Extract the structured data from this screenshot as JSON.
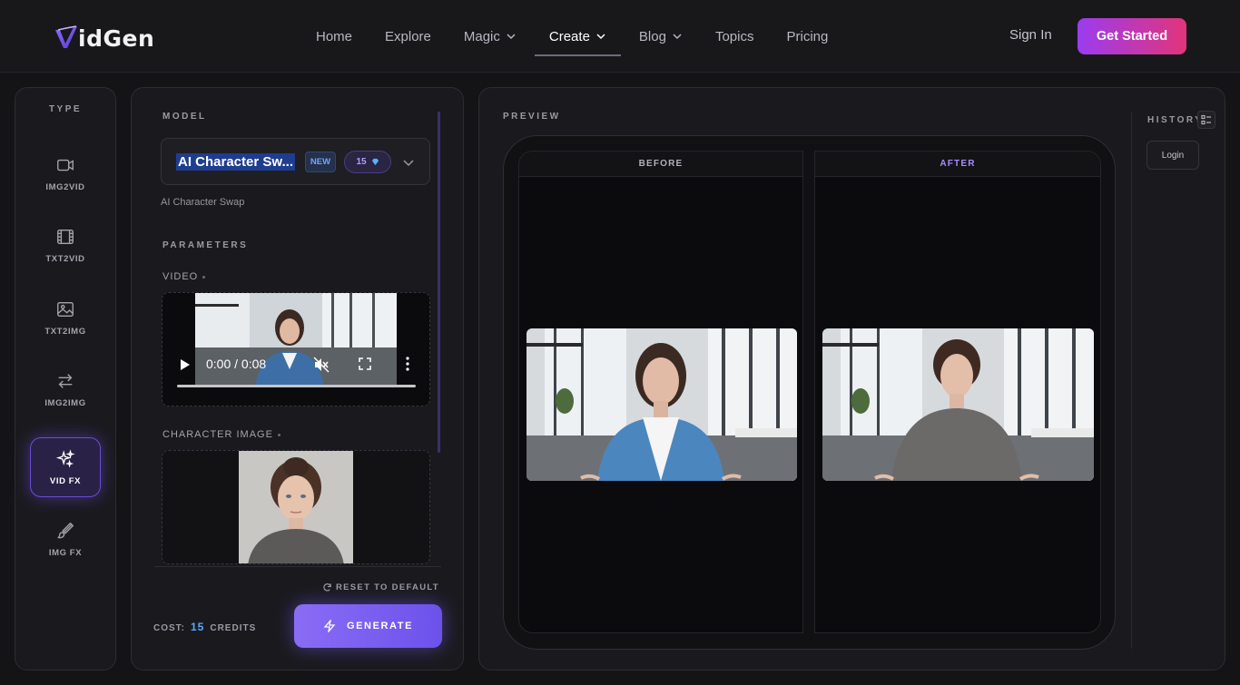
{
  "header": {
    "logo_text": "idGen",
    "nav": [
      {
        "label": "Home",
        "has_menu": false
      },
      {
        "label": "Explore",
        "has_menu": false
      },
      {
        "label": "Magic",
        "has_menu": true
      },
      {
        "label": "Create",
        "has_menu": true,
        "active": true
      },
      {
        "label": "Blog",
        "has_menu": true
      },
      {
        "label": "Topics",
        "has_menu": false
      },
      {
        "label": "Pricing",
        "has_menu": false
      }
    ],
    "sign_in": "Sign In",
    "get_started": "Get Started"
  },
  "type_panel": {
    "title": "TYPE",
    "items": [
      {
        "label": "IMG2VID",
        "icon": "video-camera-icon"
      },
      {
        "label": "TXT2VID",
        "icon": "film-icon"
      },
      {
        "label": "TXT2IMG",
        "icon": "image-icon"
      },
      {
        "label": "IMG2IMG",
        "icon": "swap-arrows-icon"
      },
      {
        "label": "VID FX",
        "icon": "sparkles-icon",
        "active": true
      },
      {
        "label": "IMG FX",
        "icon": "brush-icon"
      }
    ]
  },
  "model_panel": {
    "model_label": "MODEL",
    "model_name": "AI Character Sw...",
    "badge_new": "NEW",
    "credits_badge": "15",
    "model_description": "AI Character Swap",
    "parameters_label": "PARAMETERS",
    "video_label": "VIDEO",
    "video_time": "0:00 / 0:08",
    "character_image_label": "CHARACTER IMAGE",
    "reset_label": "RESET TO DEFAULT",
    "cost_prefix": "COST:",
    "cost_value": "15",
    "cost_suffix": "CREDITS",
    "generate_label": "GENERATE"
  },
  "preview_panel": {
    "preview_label": "PREVIEW",
    "before_label": "BEFORE",
    "after_label": "AFTER",
    "history_label": "HISTORY",
    "login_label": "Login"
  },
  "colors": {
    "accent_purple": "#7c5cff",
    "brand_gradient_start": "#9b3cf0",
    "brand_gradient_end": "#e2347a",
    "credit_blue": "#5aa7ff"
  }
}
